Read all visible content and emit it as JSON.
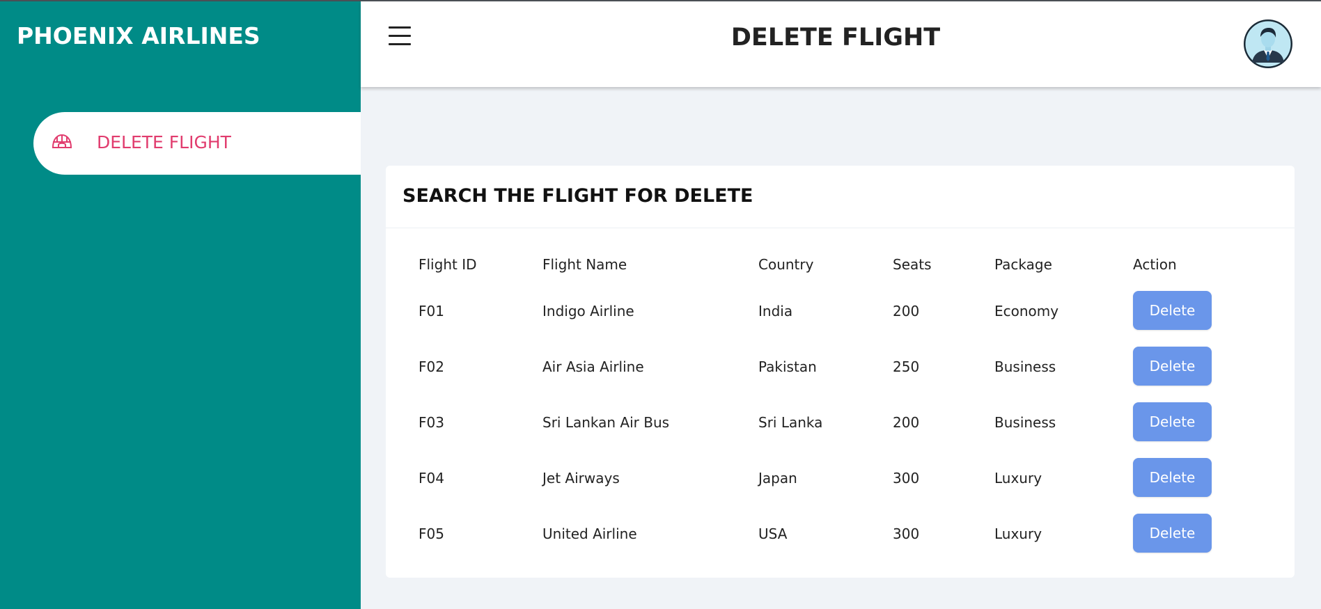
{
  "sidebar": {
    "brand": "PHOENIX AIRLINES",
    "nav_items": [
      {
        "label": "DELETE FLIGHT",
        "icon": "igloo-icon",
        "active": true
      }
    ]
  },
  "header": {
    "title": "DELETE FLIGHT",
    "menu_icon": "hamburger-menu-icon",
    "avatar_icon": "user-avatar"
  },
  "card": {
    "title": "SEARCH THE FLIGHT FOR DELETE",
    "columns": [
      "Flight ID",
      "Flight Name",
      "Country",
      "Seats",
      "Package",
      "Action"
    ],
    "rows": [
      {
        "id": "F01",
        "name": "Indigo Airline",
        "country": "India",
        "seats": "200",
        "package": "Economy",
        "action": "Delete"
      },
      {
        "id": "F02",
        "name": "Air Asia Airline",
        "country": "Pakistan",
        "seats": "250",
        "package": "Business",
        "action": "Delete"
      },
      {
        "id": "F03",
        "name": "Sri Lankan Air Bus",
        "country": "Sri Lanka",
        "seats": "200",
        "package": "Business",
        "action": "Delete"
      },
      {
        "id": "F04",
        "name": "Jet Airways",
        "country": "Japan",
        "seats": "300",
        "package": "Luxury",
        "action": "Delete"
      },
      {
        "id": "F05",
        "name": "United Airline",
        "country": "USA",
        "seats": "300",
        "package": "Luxury",
        "action": "Delete"
      }
    ]
  },
  "colors": {
    "sidebar_bg": "#008b87",
    "accent_pink": "#e13c6e",
    "button_blue": "#6a96ea",
    "page_bg": "#f0f3f7"
  }
}
